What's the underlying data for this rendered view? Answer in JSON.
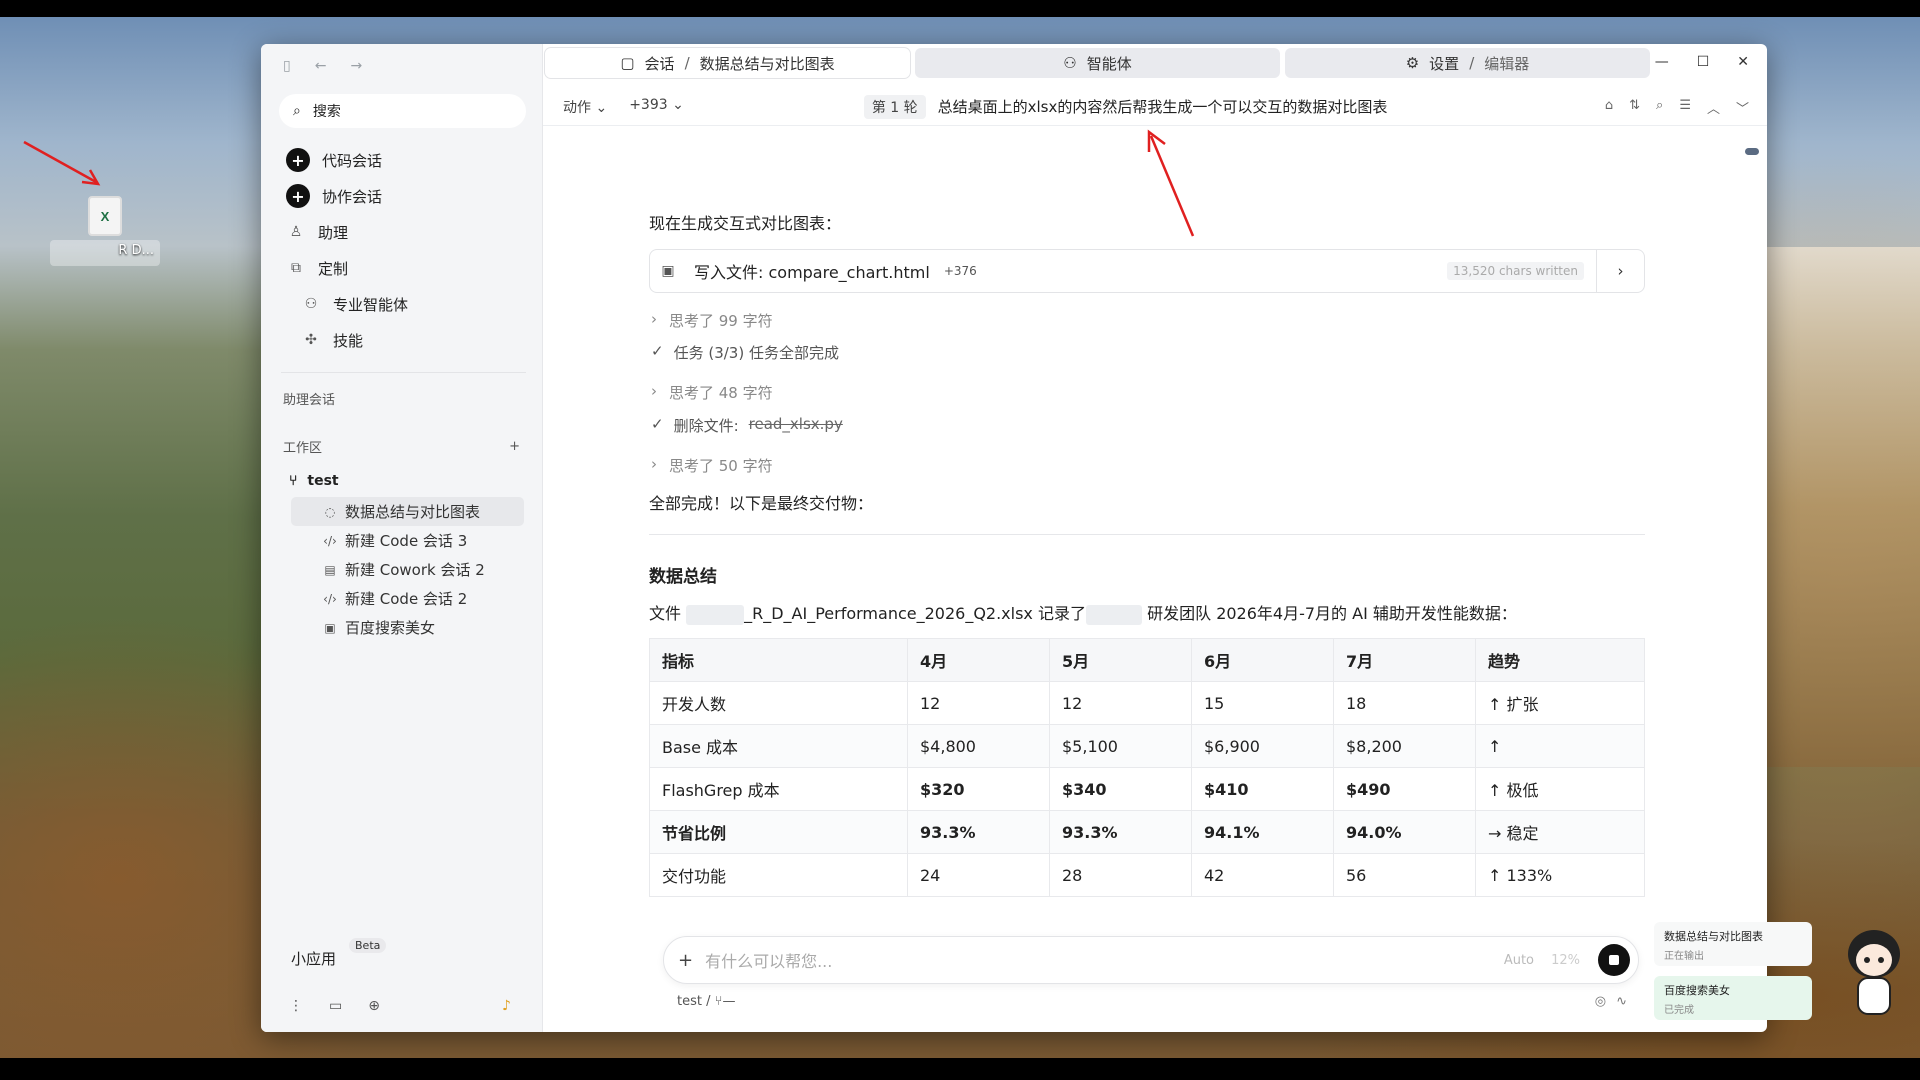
{
  "desktop": {
    "file_label": "R D..."
  },
  "sidebar": {
    "search": "搜索",
    "nav": [
      {
        "label": "代码会话"
      },
      {
        "label": "协作会话"
      },
      {
        "label": "助理"
      },
      {
        "label": "定制"
      },
      {
        "label": "专业智能体"
      },
      {
        "label": "技能"
      }
    ],
    "assistant_sessions": "助理会话",
    "workspace_title": "工作区",
    "workspace_name": "test",
    "sessions": [
      {
        "label": "数据总结与对比图表"
      },
      {
        "label": "新建 Code 会话 3"
      },
      {
        "label": "新建 Cowork 会话 2"
      },
      {
        "label": "新建 Code 会话 2"
      },
      {
        "label": "百度搜索美女"
      }
    ],
    "mini_app": "小应用",
    "beta": "Beta"
  },
  "tabs": {
    "t1": "会话",
    "t1_sep": "/",
    "t1_sub": "数据总结与对比图表",
    "t2": "智能体",
    "t3": "设置",
    "t3_sep": "/",
    "t3_sub": "编辑器"
  },
  "toolbar": {
    "action": "动作",
    "count": "+393",
    "round": "第 1 轮",
    "title": "总结桌面上的xlsx的内容然后帮我生成一个可以交互的数据对比图表"
  },
  "chat": {
    "intro": "现在生成交互式对比图表：",
    "tool_label": "写入文件: compare_chart.html",
    "tool_plus": "+376",
    "tool_chars": "13,520 chars written",
    "think1": "思考了 99 字符",
    "task": "任务 (3/3) 任务全部完成",
    "think2": "思考了 48 字符",
    "delete_prefix": "删除文件:",
    "delete_file": "read_xlsx.py",
    "think3": "思考了 50 字符",
    "done": "全部完成！以下是最终交付物：",
    "summary_title": "数据总结",
    "line_a": "文件",
    "line_file": "_R_D_AI_Performance_2026_Q2.xlsx",
    "line_b": "记录了",
    "line_c": "研发团队 2026年4月-7月的 AI 辅助开发性能数据："
  },
  "table": {
    "headers": [
      "指标",
      "4月",
      "5月",
      "6月",
      "7月",
      "趋势"
    ],
    "rows": [
      [
        "开发人数",
        "12",
        "12",
        "15",
        "18",
        "↑ 扩张"
      ],
      [
        "Base 成本",
        "$4,800",
        "$5,100",
        "$6,900",
        "$8,200",
        "↑"
      ],
      [
        "FlashGrep 成本",
        "$320",
        "$340",
        "$410",
        "$490",
        "↑ 极低"
      ],
      [
        "节省比例",
        "93.3%",
        "93.3%",
        "94.1%",
        "94.0%",
        "→ 稳定"
      ],
      [
        "交付功能",
        "24",
        "28",
        "42",
        "56",
        "↑ 133%"
      ]
    ]
  },
  "input": {
    "placeholder": "有什么可以帮您...",
    "mode": "Auto",
    "percent": "12%"
  },
  "footer": {
    "workspace": "test",
    "sep": "/",
    "branch": "—"
  },
  "notifications": [
    {
      "title": "数据总结与对比图表",
      "status": "正在输出"
    },
    {
      "title": "百度搜索美女",
      "status": "已完成"
    }
  ]
}
